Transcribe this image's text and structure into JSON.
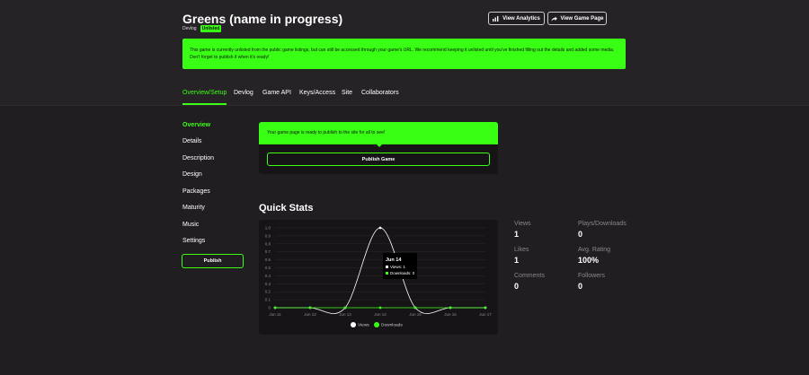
{
  "header": {
    "title": "Greens (name in progress)",
    "badge_devlog": "Devlog",
    "badge_unlisted": "Unlisted",
    "view_analytics": "View Analytics",
    "view_game_page": "View Game Page"
  },
  "notice": "This game is currently unlisted from the public game listings, but can still be accessed through your game's URL. We recommend keeping it unlisted until you've finished filling out the details and added some media. Don't forget to publish it when it's ready!",
  "nav": {
    "tabs": [
      {
        "label": "Overview/Setup",
        "active": true
      },
      {
        "label": "Devlog"
      },
      {
        "label": "Game API"
      },
      {
        "label": "Keys/Access"
      },
      {
        "label": "Site"
      },
      {
        "label": "Collaborators"
      }
    ]
  },
  "sidebar": {
    "items": [
      {
        "label": "Overview",
        "active": true
      },
      {
        "label": "Details"
      },
      {
        "label": "Description"
      },
      {
        "label": "Design"
      },
      {
        "label": "Packages"
      },
      {
        "label": "Maturity"
      },
      {
        "label": "Music"
      },
      {
        "label": "Settings"
      }
    ],
    "publish_label": "Publish"
  },
  "ready": {
    "message": "Your game page is ready to publish to the site for all to see!",
    "button": "Publish Game"
  },
  "quick_stats": {
    "title": "Quick Stats",
    "stats": [
      {
        "label": "Views",
        "value": "1"
      },
      {
        "label": "Plays/Downloads",
        "value": "0"
      },
      {
        "label": "Likes",
        "value": "1"
      },
      {
        "label": "Avg. Rating",
        "value": "100%"
      },
      {
        "label": "Comments",
        "value": "0"
      },
      {
        "label": "Followers",
        "value": "0"
      }
    ]
  },
  "chart_data": {
    "type": "line",
    "categories": [
      "Jun 11",
      "Jun 12",
      "Jun 13",
      "Jun 14",
      "Jun 15",
      "Jun 16",
      "Jun 17"
    ],
    "series": [
      {
        "name": "Views",
        "values": [
          0,
          0,
          0,
          1,
          0,
          0,
          0
        ],
        "color": "#ffffff"
      },
      {
        "name": "Downloads",
        "values": [
          0,
          0,
          0,
          0,
          0,
          0,
          0
        ],
        "color": "#39ff14"
      }
    ],
    "yticks": [
      "1.0",
      "0.9",
      "0.8",
      "0.7",
      "0.6",
      "0.5",
      "0.4",
      "0.3",
      "0.2",
      "0.1",
      "0"
    ],
    "ylim": [
      0,
      1
    ],
    "tooltip": {
      "title": "Jun 14",
      "lines": [
        "Views: 1",
        "Downloads: 0"
      ]
    },
    "legend": "bottom-center"
  },
  "colors": {
    "accent": "#39ff14",
    "background": "#211e21",
    "card": "#161416"
  }
}
